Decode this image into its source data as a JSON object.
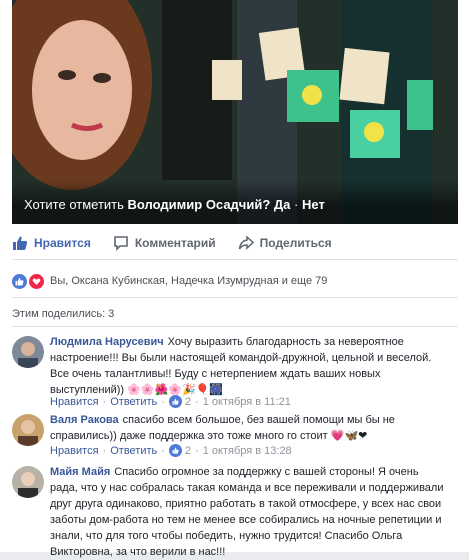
{
  "post": {
    "tag_prompt": {
      "question": "Хотите отметить",
      "person": "Володимир Осадчий?",
      "yes": "Да",
      "sep": "·",
      "no": "Нет"
    },
    "actions": {
      "like": "Нравится",
      "comment": "Комментарий",
      "share": "Поделиться"
    },
    "reactions_text": "Вы, Оксана Кубинская, Надечка Изумрудная и еще 79",
    "shares_text": "Этим поделились: 3",
    "colors": {
      "link": "#385898",
      "like_blue": "#4267b2",
      "reaction_red": "#f0284a"
    }
  },
  "comments": [
    {
      "author": "Людмила Нарусевич",
      "line1": "Хочу выразить благодарность за невероятное",
      "line2": "настроение!!! Вы были настоящей командой-дружной, цельной и веселой.",
      "line3": "Все очень талантливы!! Буду с нетерпением ждать ваших новых",
      "line4": "выступлений))",
      "emoji": "🌸🌸🌺🌸🎉🎈🎆",
      "like_label": "Нравится",
      "reply_label": "Ответить",
      "likes": "2",
      "time": "1 октября в 11:21"
    },
    {
      "author": "Валя Ракова",
      "line1": "спасибо всем большое, без вашей помощи мы бы не",
      "line2": "справились)) даже поддержка это тоже много го стоит",
      "emoji": "💗🦋❤",
      "like_label": "Нравится",
      "reply_label": "Ответить",
      "likes": "2",
      "time": "1 октября в 13:28"
    },
    {
      "author": "Майя Майя",
      "line1": "Спасибо огромное за поддержку с вашей стороны! Я очень",
      "line2": "рада, что у нас собралась такая команда и все переживали и поддерживали",
      "line3": "друг друга одинаково, приятно работать в такой отмосфере, у всех нас свои",
      "line4": "заботы дом-работа но тем не менее все собирались на ночные репетиции и",
      "line5": "знали, что для того чтобы победить, нужно трудится! Спасибо Ольга",
      "line6": "Викторовна, за что верили в нас!!!"
    }
  ]
}
